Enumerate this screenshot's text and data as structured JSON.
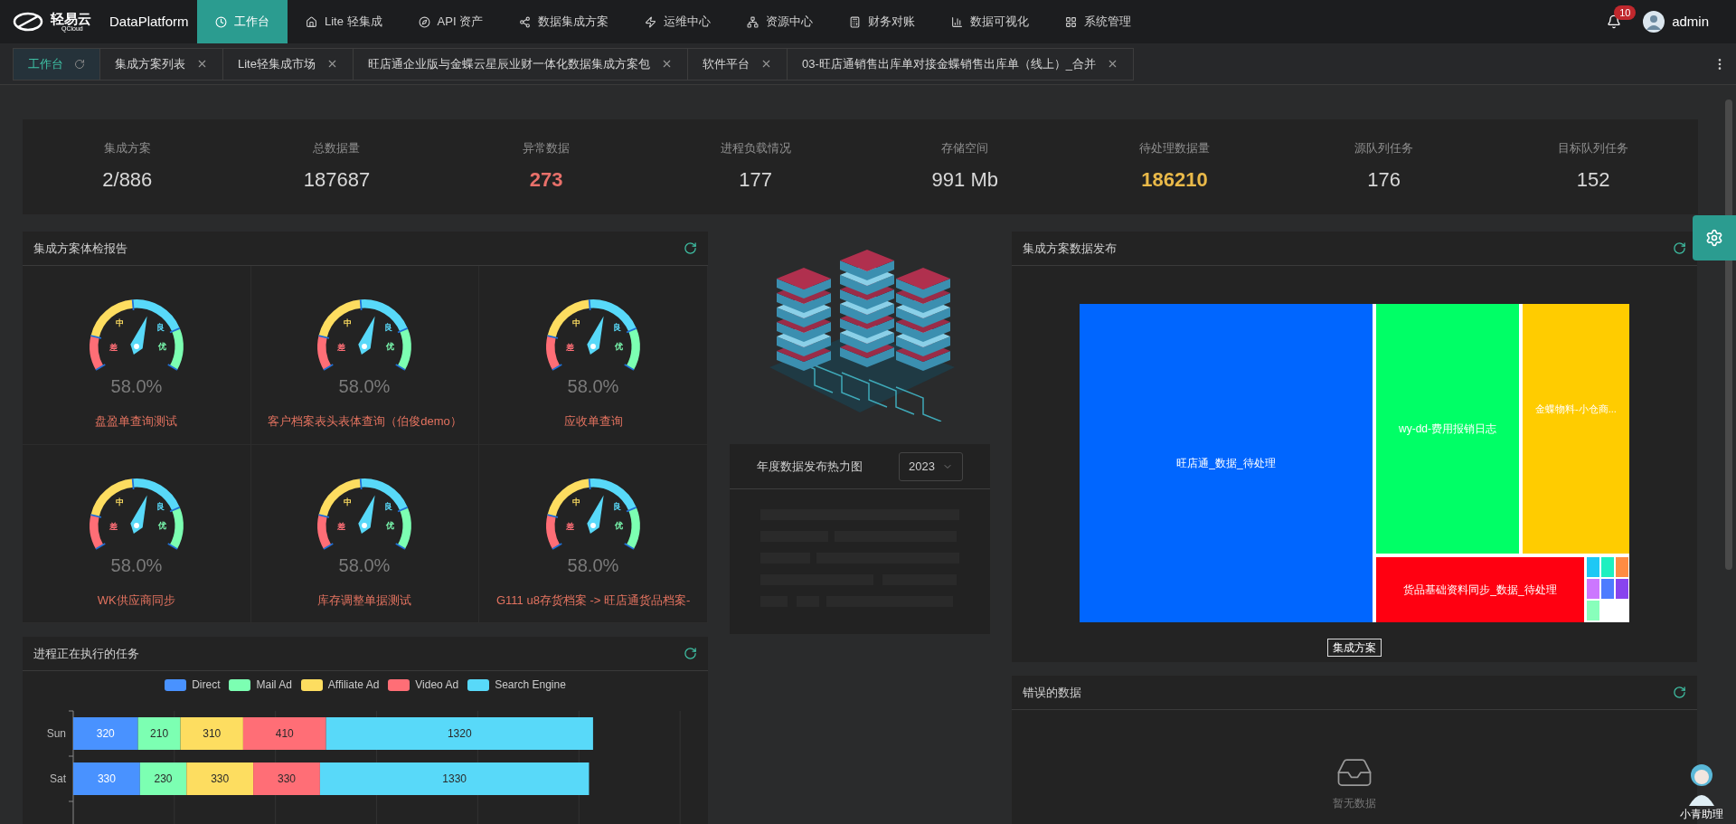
{
  "nav": {
    "logo_text": "轻易云",
    "logo_subtext": "QCloud",
    "product": "DataPlatform",
    "items": [
      {
        "label": "工作台",
        "selected": true
      },
      {
        "label": "Lite 轻集成",
        "selected": false
      },
      {
        "label": "API 资产",
        "selected": false
      },
      {
        "label": "数据集成方案",
        "selected": false
      },
      {
        "label": "运维中心",
        "selected": false
      },
      {
        "label": "资源中心",
        "selected": false
      },
      {
        "label": "财务对账",
        "selected": false
      },
      {
        "label": "数据可视化",
        "selected": false
      },
      {
        "label": "系统管理",
        "selected": false
      }
    ],
    "notification_count": "10",
    "user": "admin"
  },
  "tabs": [
    {
      "label": "工作台",
      "selected": true,
      "kind": "home"
    },
    {
      "label": "集成方案列表",
      "selected": false,
      "kind": "page"
    },
    {
      "label": "Lite轻集成市场",
      "selected": false,
      "kind": "page"
    },
    {
      "label": "旺店通企业版与金蝶云星辰业财一体化数据集成方案包",
      "selected": false,
      "kind": "page"
    },
    {
      "label": "软件平台",
      "selected": false,
      "kind": "page"
    },
    {
      "label": "03-旺店通销售出库单对接金蝶销售出库单（线上）_合并",
      "selected": false,
      "kind": "page"
    }
  ],
  "stats": [
    {
      "label": "集成方案",
      "value": "2/886",
      "kind": "plain"
    },
    {
      "label": "总数据量",
      "value": "187687",
      "kind": "plain"
    },
    {
      "label": "异常数据",
      "value": "273",
      "kind": "error"
    },
    {
      "label": "进程负载情况",
      "value": "177",
      "kind": "plain"
    },
    {
      "label": "存储空间",
      "value": "991 Mb",
      "kind": "plain"
    },
    {
      "label": "待处理数据量",
      "value": "186210",
      "kind": "warning"
    },
    {
      "label": "源队列任务",
      "value": "176",
      "kind": "plain"
    },
    {
      "label": "目标队列任务",
      "value": "152",
      "kind": "plain"
    }
  ],
  "health_report": {
    "title": "集成方案体检报告",
    "gauges": [
      {
        "name": "盘盈单查询测试",
        "reading": "58.0%",
        "scale_labels": [
          "差",
          "中",
          "良",
          "优"
        ]
      },
      {
        "name": "客户档案表头表体查询（伯俊demo）",
        "reading": "58.0%",
        "scale_labels": [
          "差",
          "中",
          "良",
          "优"
        ]
      },
      {
        "name": "应收单查询",
        "reading": "58.0%",
        "scale_labels": [
          "差",
          "中",
          "良",
          "优"
        ]
      },
      {
        "name": "WK供应商同步",
        "reading": "58.0%",
        "scale_labels": [
          "差",
          "中",
          "良",
          "优"
        ]
      },
      {
        "name": "库存调整单据测试",
        "reading": "58.0%",
        "scale_labels": [
          "差",
          "中",
          "良",
          "优"
        ]
      },
      {
        "name": "G111 u8存货档案 -> 旺店通货品档案-",
        "reading": "58.0%",
        "scale_labels": [
          "差",
          "中",
          "良",
          "优"
        ]
      }
    ]
  },
  "tasks": {
    "title": "进程正在执行的任务",
    "chart_data": {
      "type": "bar",
      "orientation": "horizontal",
      "stacked": true,
      "data_labels": true,
      "categories": [
        "Sun",
        "Sat"
      ],
      "series": [
        {
          "name": "Direct",
          "color": "#4992ff",
          "values": [
            320,
            330
          ]
        },
        {
          "name": "Mail Ad",
          "color": "#7cffb2",
          "values": [
            210,
            230
          ]
        },
        {
          "name": "Affiliate Ad",
          "color": "#fddd60",
          "values": [
            310,
            330
          ]
        },
        {
          "name": "Video Ad",
          "color": "#ff6e76",
          "values": [
            410,
            330
          ]
        },
        {
          "name": "Search Engine",
          "color": "#58d9f9",
          "values": [
            1320,
            1330
          ]
        }
      ]
    }
  },
  "heatmap": {
    "title": "年度数据发布热力图",
    "year": "2023"
  },
  "distribution": {
    "title": "集成方案数据发布",
    "legend": "集成方案",
    "nodes": [
      {
        "label": "旺店通_数据_待处理",
        "color": "#0066ff"
      },
      {
        "label": "wy-dd-费用报销日志",
        "color": "#00ff66"
      },
      {
        "label": "金蝶物料-小仓商...",
        "color": "#ffcc00"
      },
      {
        "label": "货品基础资料同步_数据_待处理",
        "color": "#ff0011"
      }
    ],
    "small_tiles": [
      {
        "color": "#1ec8f5"
      },
      {
        "color": "#1ef0c0"
      },
      {
        "color": "#ff8c42"
      },
      {
        "color": "#cc77ff"
      },
      {
        "color": "#4d7cff"
      },
      {
        "color": "#8844ee"
      },
      {
        "color": "#88ffbb"
      }
    ]
  },
  "errors": {
    "title": "错误的数据",
    "empty_text": "暂无数据"
  },
  "assistant": {
    "label": "小青助理"
  }
}
